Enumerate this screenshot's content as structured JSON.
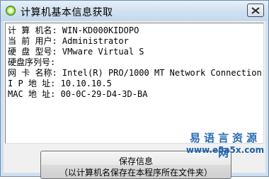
{
  "window": {
    "title": "计算机基本信息获取",
    "icon": "green-orb-icon",
    "close_icon": "close-icon"
  },
  "info": {
    "rows": [
      {
        "label": "计 算 机名:",
        "value": "WIN-KD000KIDOPO"
      },
      {
        "label": "当 前 用户:",
        "value": "Administrator"
      },
      {
        "label": "硬 盘 型号:",
        "value": "VMware Virtual S"
      },
      {
        "label": "硬盘序列号:",
        "value": ""
      },
      {
        "label": "网 卡 名称:",
        "value": "Intel(R) PRO/1000 MT Network Connection"
      },
      {
        "label": "I P 地 址:",
        "value": "10.10.10.5"
      },
      {
        "label": "MAC 地 址:",
        "value": "00-0C-29-D4-3D-BA"
      }
    ]
  },
  "save_button": {
    "label": "保存信息",
    "hint": "（以计算机名保存在本程序所在文件夹）"
  },
  "watermark": {
    "text": "易语言资源网",
    "url": "www.e5a5x.com"
  },
  "colors": {
    "frame": "#cfe0f0",
    "watermark": "#2a6db2"
  }
}
